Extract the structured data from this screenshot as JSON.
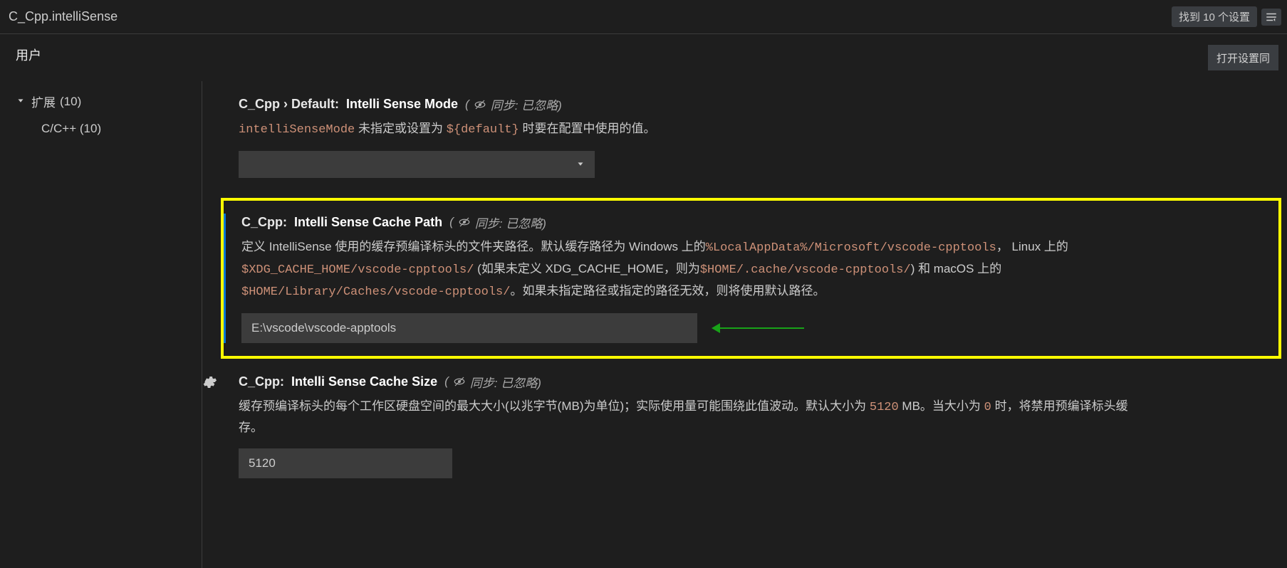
{
  "search": {
    "query": "C_Cpp.intelliSense",
    "count_label": "找到 10 个设置"
  },
  "tabs": {
    "user": "用户",
    "open_sync": "打开设置同"
  },
  "sidebar": {
    "root": {
      "label": "扩展",
      "count": "(10)"
    },
    "sub": {
      "label": "C/C++",
      "count": "(10)"
    }
  },
  "sync_text": "同步: 已忽略)",
  "sync_paren_open": "(",
  "settings": {
    "mode": {
      "prefix": "C_Cpp › Default:",
      "name": "Intelli Sense Mode",
      "desc_pre": "intelliSenseMode",
      "desc_mid": " 未指定或设置为 ",
      "desc_code": "${default}",
      "desc_post": " 时要在配置中使用的值。"
    },
    "cache_path": {
      "prefix": "C_Cpp:",
      "name": "Intelli Sense Cache Path",
      "d1": "定义 IntelliSense 使用的缓存预编译标头的文件夹路径。默认缓存路径为 Windows 上的",
      "c1": "%LocalAppData%/Microsoft/vscode-cpptools",
      "d2": "，  Linux 上的 ",
      "c2": "$XDG_CACHE_HOME/vscode-cpptools/",
      "d3": " (如果未定义 XDG_CACHE_HOME，则为",
      "c3": "$HOME/.cache/vscode-cpptools/",
      "d4": ") 和 macOS 上的 ",
      "c4": "$HOME/Library/Caches/vscode-cpptools/",
      "d5": "。如果未指定路径或指定的路径无效，则将使用默认路径。",
      "value": "E:\\vscode\\vscode-apptools"
    },
    "cache_size": {
      "prefix": "C_Cpp:",
      "name": "Intelli Sense Cache Size",
      "d1": "缓存预编译标头的每个工作区硬盘空间的最大大小(以兆字节(MB)为单位)；实际使用量可能围绕此值波动。默认大小为 ",
      "c1": "5120",
      "d2": " MB。当大小为 ",
      "c2": "0",
      "d3": " 时，将禁用预编译标头缓存。",
      "value": "5120"
    }
  }
}
